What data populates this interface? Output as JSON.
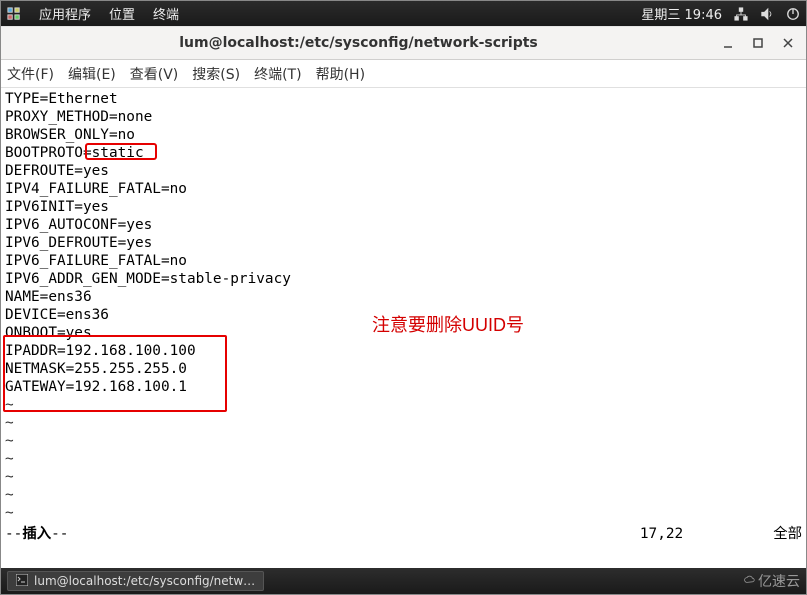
{
  "sysbar": {
    "menu_apps": "应用程序",
    "menu_places": "位置",
    "menu_terminal": "终端",
    "clock": "星期三 19:46"
  },
  "window": {
    "title": "lum@localhost:/etc/sysconfig/network-scripts"
  },
  "menubar": {
    "file": "文件(F)",
    "edit": "编辑(E)",
    "view": "查看(V)",
    "search": "搜索(S)",
    "terminal": "终端(T)",
    "help": "帮助(H)"
  },
  "config_lines": [
    "TYPE=Ethernet",
    "PROXY_METHOD=none",
    "BROWSER_ONLY=no",
    "BOOTPROTO=static",
    "DEFROUTE=yes",
    "IPV4_FAILURE_FATAL=no",
    "IPV6INIT=yes",
    "IPV6_AUTOCONF=yes",
    "IPV6_DEFROUTE=yes",
    "IPV6_FAILURE_FATAL=no",
    "IPV6_ADDR_GEN_MODE=stable-privacy",
    "NAME=ens36",
    "DEVICE=ens36",
    "ONBOOT=yes",
    "IPADDR=192.168.100.100",
    "NETMASK=255.255.255.0",
    "GATEWAY=192.168.100.1"
  ],
  "tilde": "~",
  "annotation": "注意要删除UUID号",
  "vim": {
    "mode_prefix": "-- ",
    "mode": "插入",
    "mode_suffix": " --",
    "position": "17,22",
    "scroll": "全部"
  },
  "taskbar": {
    "item": "lum@localhost:/etc/sysconfig/netw…",
    "brand": "亿速云"
  }
}
